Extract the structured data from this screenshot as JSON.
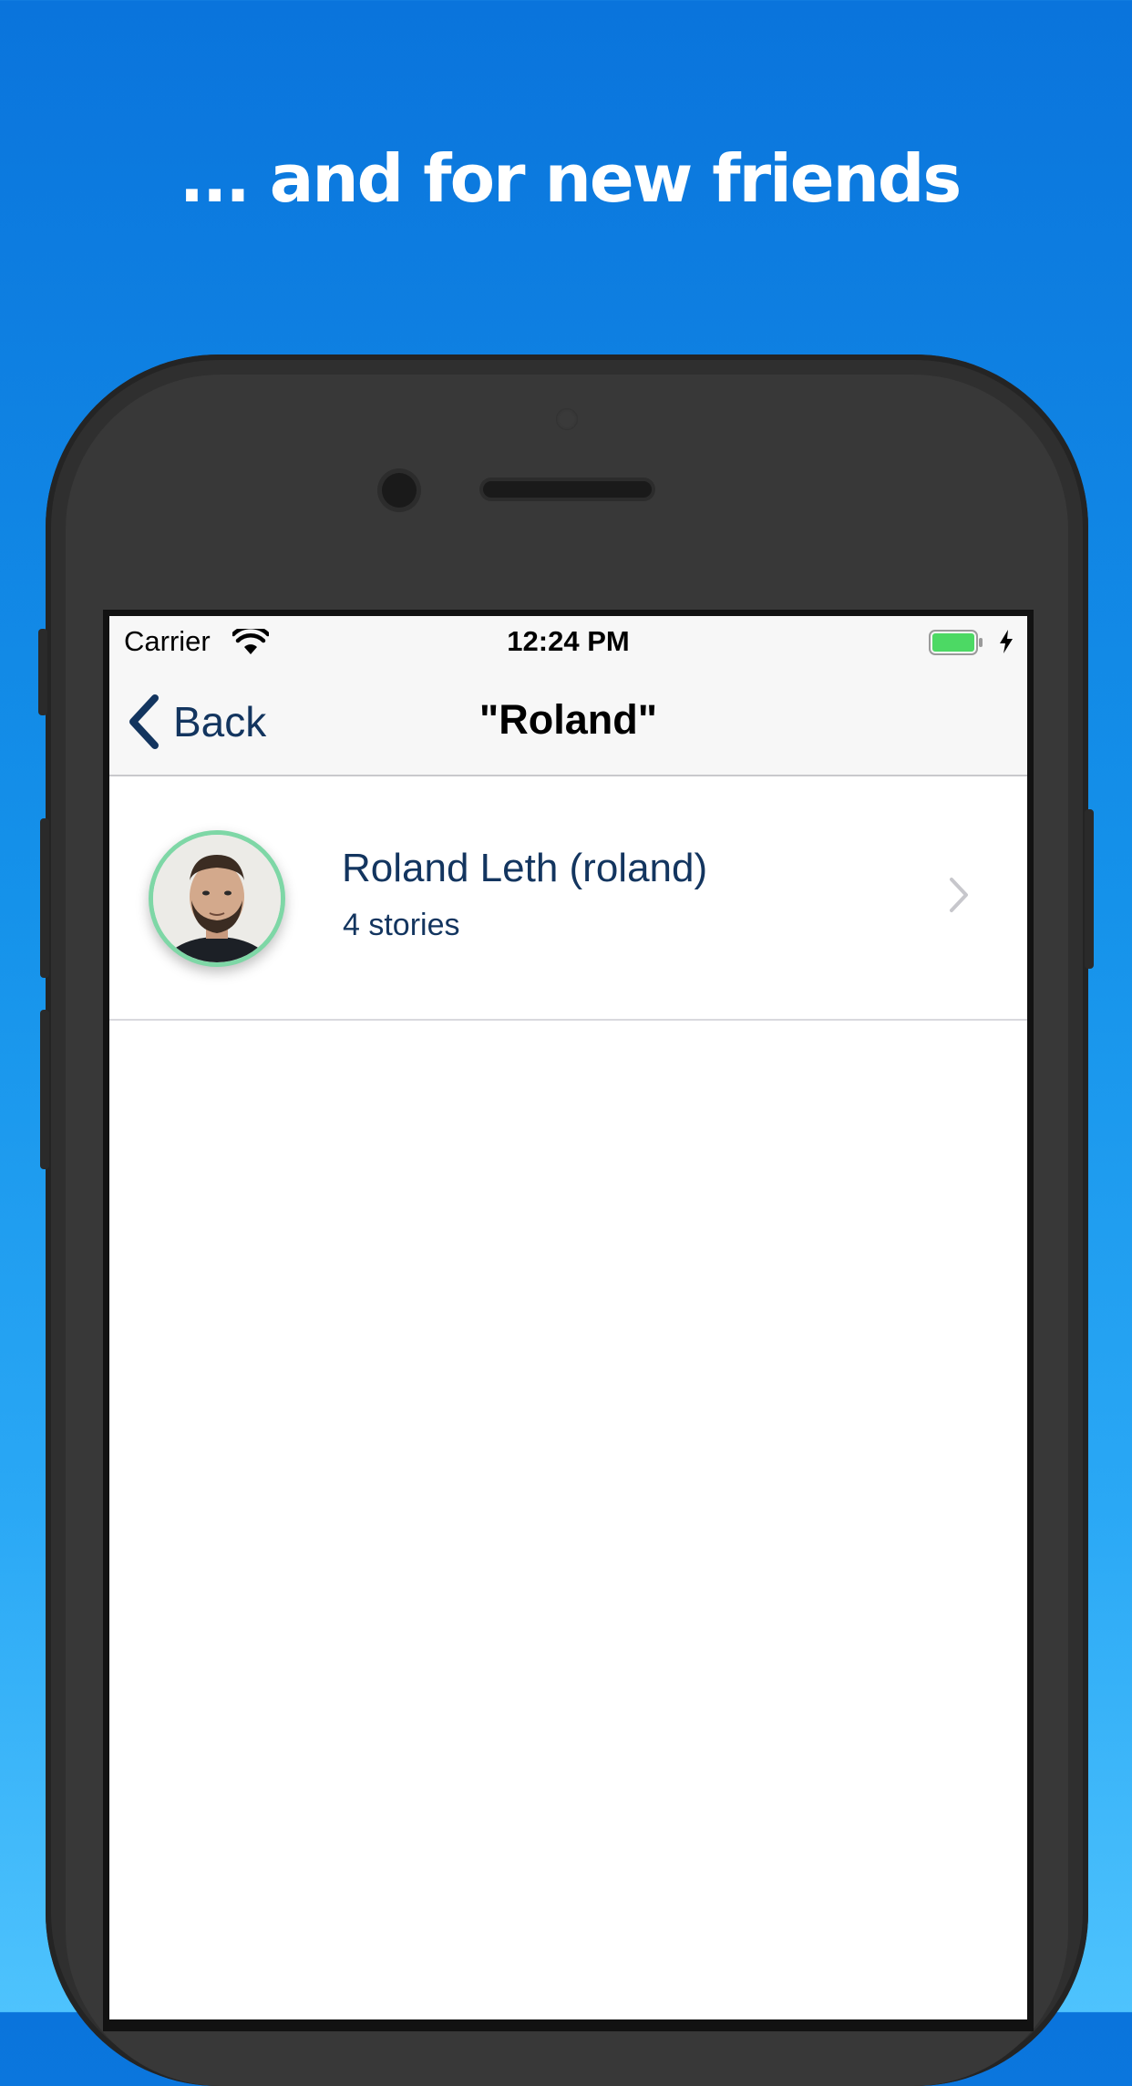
{
  "headline": "... and for new friends",
  "status_bar": {
    "carrier": "Carrier",
    "time": "12:24 PM",
    "wifi_icon": "wifi-icon",
    "battery_icon": "battery-charging-icon",
    "battery_color": "#4cd964"
  },
  "nav_bar": {
    "back_label": "Back",
    "title": "\"Roland\""
  },
  "results": [
    {
      "name": "Roland Leth (roland)",
      "subtitle": "4 stories",
      "avatar_border_color": "#7ed7a6"
    }
  ],
  "colors": {
    "accent": "#13355f",
    "background_top": "#0a74dc",
    "background_bottom": "#4ec3fd"
  }
}
